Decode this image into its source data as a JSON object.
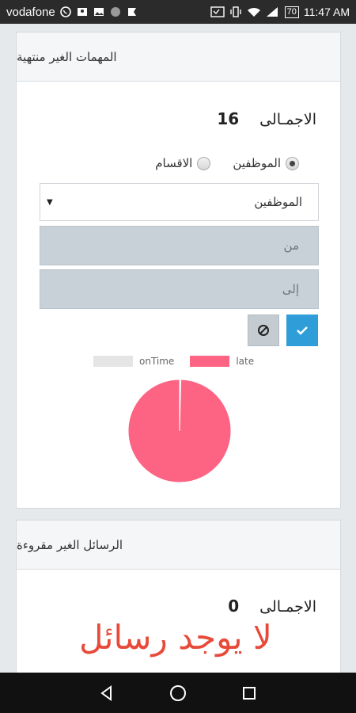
{
  "status_bar": {
    "carrier": "vodafone",
    "time": "11:47 AM",
    "battery": "70"
  },
  "tasks_card": {
    "title": "المهمات الغير منتهية",
    "total_label": "الاجمـالى",
    "total_value": "16",
    "radio_employees": "الموظفين",
    "radio_departments": "الاقسام",
    "selected_radio": "employees",
    "select_value": "الموظفين",
    "from_placeholder": "من",
    "to_placeholder": "إلى",
    "chart_data": {
      "type": "pie",
      "legend": [
        "onTime",
        "late"
      ],
      "series": [
        {
          "name": "onTime",
          "value": 0.4
        },
        {
          "name": "late",
          "value": 99.6
        }
      ],
      "colors": {
        "onTime": "#e5e5e5",
        "late": "#fd6382"
      }
    }
  },
  "messages_card": {
    "title": "الرسائل الغير مقروءة",
    "total_label": "الاجمـالى",
    "total_value": "0",
    "empty_message": "لا يوجد رسائل"
  },
  "colors": {
    "accent_blue": "#2f9ed8",
    "late_pink": "#fd6382",
    "ontime_gray": "#e5e5e5",
    "empty_red": "#e84a3a"
  }
}
